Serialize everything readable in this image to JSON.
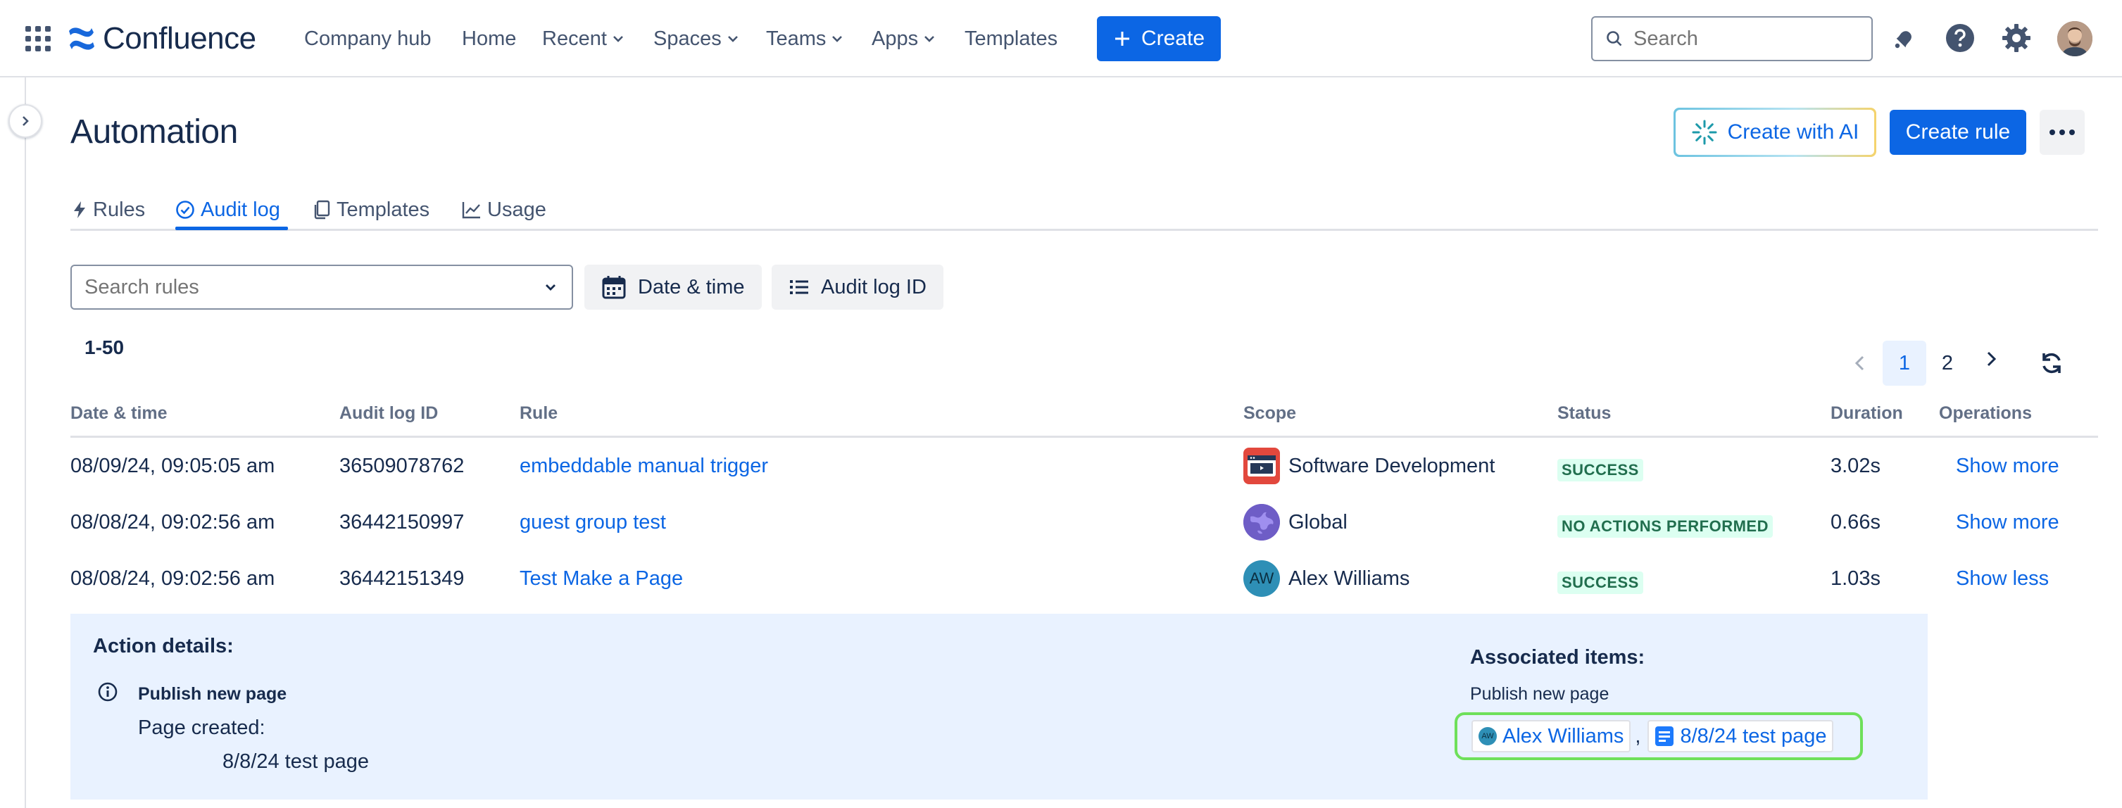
{
  "app": {
    "name": "Confluence"
  },
  "nav": {
    "items": [
      {
        "label": "Company hub",
        "dropdown": false
      },
      {
        "label": "Home",
        "dropdown": false
      },
      {
        "label": "Recent",
        "dropdown": true
      },
      {
        "label": "Spaces",
        "dropdown": true
      },
      {
        "label": "Teams",
        "dropdown": true
      },
      {
        "label": "Apps",
        "dropdown": true
      },
      {
        "label": "Templates",
        "dropdown": false
      }
    ],
    "create_label": "Create",
    "search_placeholder": "Search",
    "icons": [
      "app-switcher-icon",
      "notifications-icon",
      "help-icon",
      "settings-icon",
      "profile-avatar"
    ]
  },
  "page": {
    "title": "Automation",
    "create_ai_label": "Create with AI",
    "create_rule_label": "Create rule"
  },
  "tabs": [
    {
      "label": "Rules",
      "icon": "lightning-icon",
      "active": false
    },
    {
      "label": "Audit log",
      "icon": "check-circle-icon",
      "active": true
    },
    {
      "label": "Templates",
      "icon": "copy-icon",
      "active": false
    },
    {
      "label": "Usage",
      "icon": "line-chart-icon",
      "active": false
    }
  ],
  "filters": {
    "search_placeholder": "Search rules",
    "date_time_label": "Date & time",
    "audit_log_id_label": "Audit log ID"
  },
  "results": {
    "range": "1-50",
    "pages": [
      "1",
      "2"
    ],
    "current_page": "1"
  },
  "table": {
    "columns": [
      "Date & time",
      "Audit log ID",
      "Rule",
      "Scope",
      "Status",
      "Duration",
      "Operations"
    ],
    "rows": [
      {
        "datetime": "08/09/24, 09:05:05 am",
        "audit_id": "36509078762",
        "rule": "embeddable manual trigger",
        "scope": "Software Development",
        "scope_icon": "space-icon",
        "status": "SUCCESS",
        "duration": "3.02s",
        "operation": "Show more"
      },
      {
        "datetime": "08/08/24, 09:02:56 am",
        "audit_id": "36442150997",
        "rule": "guest group test",
        "scope": "Global",
        "scope_icon": "globe-icon",
        "status": "NO ACTIONS PERFORMED",
        "duration": "0.66s",
        "operation": "Show more"
      },
      {
        "datetime": "08/08/24, 09:02:56 am",
        "audit_id": "36442151349",
        "rule": "Test Make a Page",
        "scope": "Alex Williams",
        "scope_icon": "AW",
        "status": "SUCCESS",
        "duration": "1.03s",
        "operation": "Show less"
      }
    ]
  },
  "details": {
    "action_title": "Action details:",
    "action_name": "Publish new page",
    "page_created_label": "Page created:",
    "page_created_value": "8/8/24 test page",
    "associated_title": "Associated items:",
    "associated_action": "Publish new page",
    "associated_user": "Alex Williams",
    "associated_user_initials": "AW",
    "associated_separator": ",",
    "associated_page": "8/8/24 test page"
  },
  "colors": {
    "brand_blue": "#0c66e4",
    "success_bg": "#dcfff1",
    "success_text": "#216e4e",
    "details_bg": "#e9f2ff",
    "highlight_border": "#6ee05a"
  }
}
